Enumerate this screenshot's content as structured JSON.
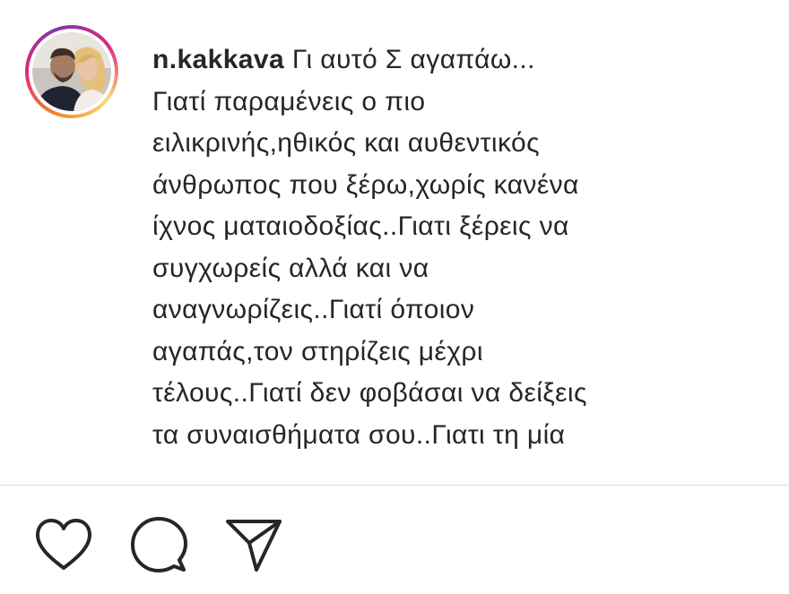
{
  "post": {
    "username": "n.kakkava",
    "caption_lines": [
      "Γι αυτό Σ αγαπάω...",
      "Γιατί παραμένεις ο πιο",
      "ειλικρινής,ηθικός και αυθεντικός",
      "άνθρωπος που ξέρω,χωρίς κανένα",
      "ίχνος ματαιοδοξίας..Γιατι ξέρεις να",
      "συγχωρείς αλλά και να",
      "αναγνωρίζεις..Γιατί όποιον",
      "αγαπάς,τον στηρίζεις μέχρι",
      "τέλους..Γιατί δεν φοβάσαι να δείξεις",
      "τα συναισθήματα σου..Γιατι τη μία"
    ]
  },
  "actions": {
    "icons": [
      "heart-icon",
      "comment-icon",
      "share-icon"
    ]
  },
  "colors": {
    "text": "#262626",
    "divider": "#dbdbdb",
    "ring_start": "#f58529",
    "ring_mid": "#dd2a7b",
    "ring_end": "#8134af"
  }
}
